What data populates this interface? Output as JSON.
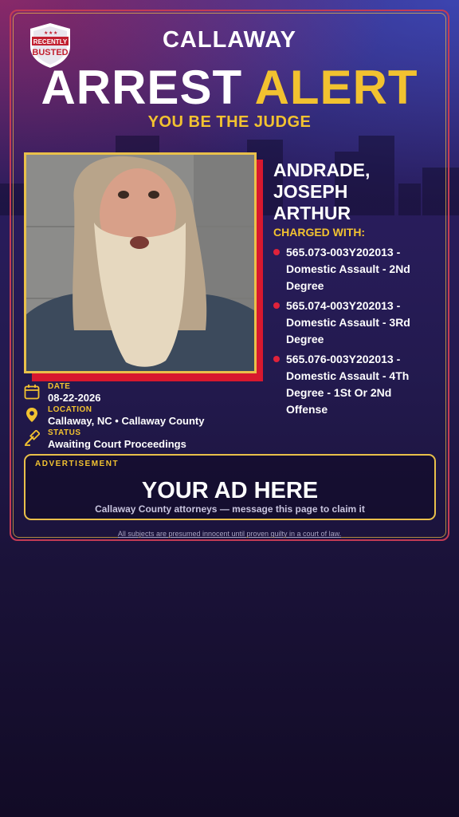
{
  "badge": {
    "line1": "RECENTLY",
    "line2": "BUSTED"
  },
  "header": {
    "city": "CALLAWAY",
    "alert_word1": "ARREST",
    "alert_word2": "ALERT",
    "subtitle": "YOU BE THE JUDGE"
  },
  "subject": {
    "name_line1": "ANDRADE,",
    "name_line2": "JOSEPH",
    "name_line3": "ARTHUR"
  },
  "charges_label": "CHARGED WITH:",
  "charges": [
    {
      "text": "565.073-003Y202013 - Domestic Assault - 2Nd Degree"
    },
    {
      "text": "565.074-003Y202013 - Domestic Assault - 3Rd Degree"
    },
    {
      "text": "565.076-003Y202013 - Domestic Assault - 4Th Degree - 1St Or 2Nd Offense"
    }
  ],
  "details": {
    "date_label": "DATE",
    "date_value": "08-22-2026",
    "location_label": "LOCATION",
    "location_value": "Callaway, NC • Callaway County",
    "status_label": "STATUS",
    "status_value": "Awaiting Court Proceedings"
  },
  "ad": {
    "label": "ADVERTISEMENT",
    "title": "YOUR AD HERE",
    "subtitle": "Callaway County attorneys — message this page to claim it"
  },
  "disclaimer": "All subjects are presumed innocent until proven guilty in a court of law.",
  "icons": {
    "badge": "shield-badge-icon",
    "date": "calendar-icon",
    "location": "map-pin-icon",
    "status": "gavel-icon"
  },
  "colors": {
    "accent_gold": "#f2c230",
    "accent_red": "#d8182e",
    "frame_red": "#c33b55"
  }
}
